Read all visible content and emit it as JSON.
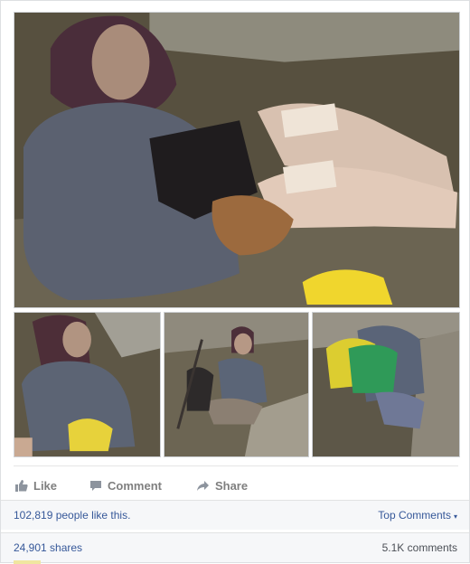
{
  "post": {
    "actions": {
      "like": "Like",
      "comment": "Comment",
      "share": "Share"
    },
    "likes_text": "102,819 people like this.",
    "top_comments": "Top Comments",
    "top_comments_caret": "▾",
    "shares_text": "24,901 shares",
    "comments_count": "5.1K comments"
  },
  "colors": {
    "link": "#365899",
    "action_gray": "#7f7f7f",
    "stats_bg": "#f6f7f9"
  },
  "icons": {
    "like": "thumbs-up-icon",
    "comment": "speech-bubble-icon",
    "share": "share-arrow-icon"
  }
}
